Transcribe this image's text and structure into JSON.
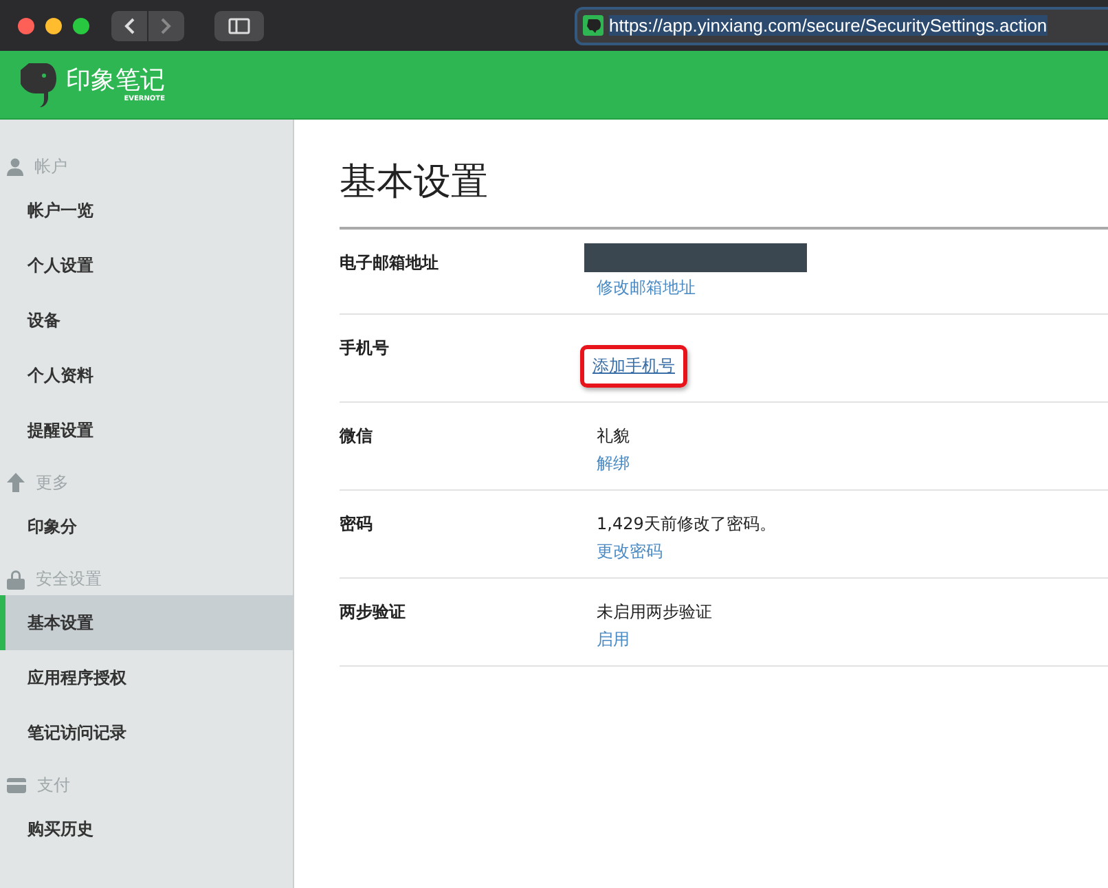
{
  "browser": {
    "url": "https://app.yinxiang.com/secure/SecuritySettings.action"
  },
  "header": {
    "logo_text": "印象笔记",
    "logo_subtext": "EVERNOTE"
  },
  "sidebar": {
    "sections": [
      {
        "title": "帐户",
        "kind": "person",
        "items": [
          {
            "label": "帐户一览",
            "selected": false
          },
          {
            "label": "个人设置",
            "selected": false
          },
          {
            "label": "设备",
            "selected": false
          },
          {
            "label": "个人资料",
            "selected": false
          },
          {
            "label": "提醒设置",
            "selected": false
          }
        ]
      },
      {
        "title": "更多",
        "kind": "arrow",
        "items": [
          {
            "label": "印象分",
            "selected": false
          }
        ]
      },
      {
        "title": "安全设置",
        "kind": "lock",
        "items": [
          {
            "label": "基本设置",
            "selected": true
          },
          {
            "label": "应用程序授权",
            "selected": false
          },
          {
            "label": "笔记访问记录",
            "selected": false
          }
        ]
      },
      {
        "title": "支付",
        "kind": "card",
        "items": [
          {
            "label": "购买历史",
            "selected": false
          }
        ]
      }
    ]
  },
  "main": {
    "title": "基本设置",
    "rows": [
      {
        "label": "电子邮箱地址",
        "redacted": true,
        "link": "修改邮箱地址",
        "highlighted": false
      },
      {
        "label": "手机号",
        "redacted": false,
        "link": "添加手机号",
        "highlighted": true
      },
      {
        "label": "微信",
        "redacted": false,
        "value": "礼貌",
        "link": "解绑",
        "highlighted": false
      },
      {
        "label": "密码",
        "redacted": false,
        "value": "1,429天前修改了密码。",
        "link": "更改密码",
        "highlighted": false
      },
      {
        "label": "两步验证",
        "redacted": false,
        "value": "未启用两步验证",
        "link": "启用",
        "highlighted": false
      }
    ]
  }
}
